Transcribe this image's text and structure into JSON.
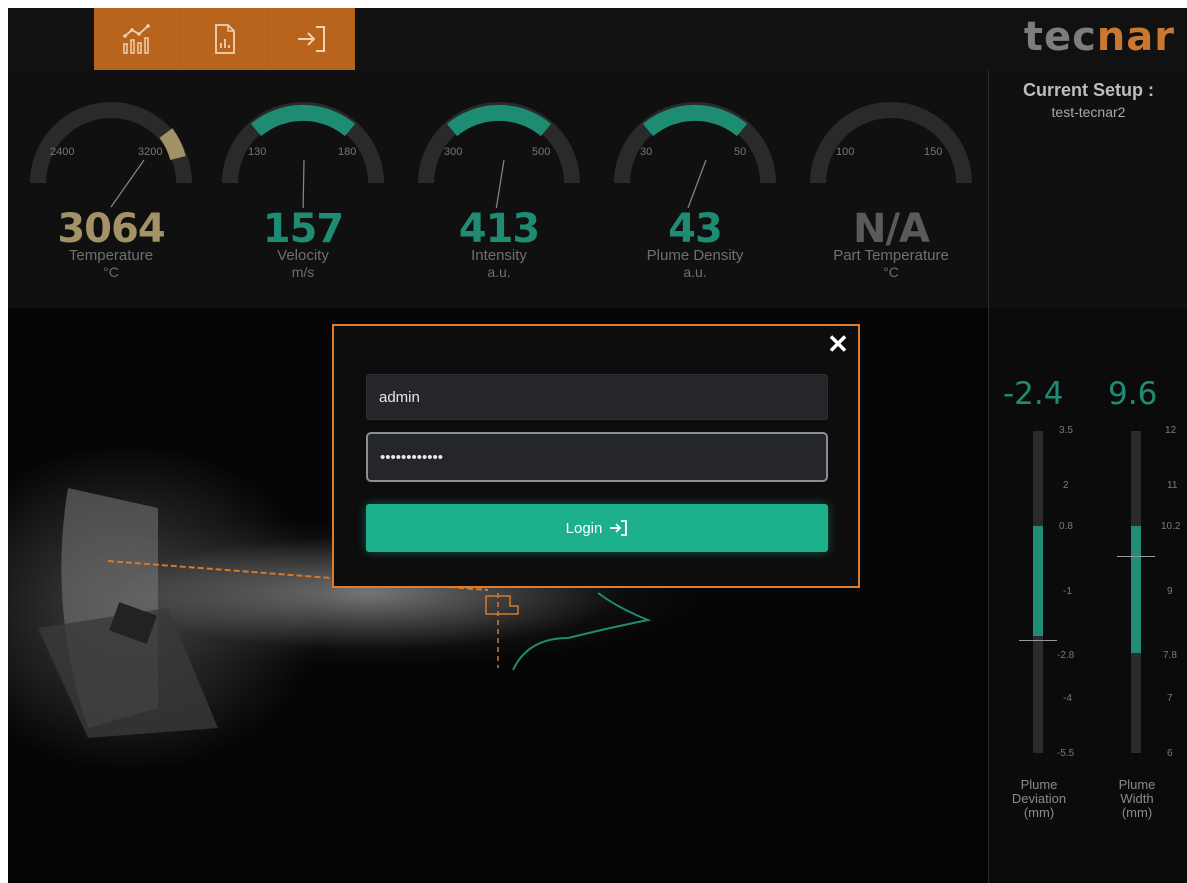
{
  "nav": {
    "tabs": [
      {
        "icon": "video-camera-icon"
      },
      {
        "icon": "chart-icon"
      },
      {
        "icon": "report-icon"
      },
      {
        "icon": "login-icon"
      }
    ]
  },
  "brand": {
    "logo_part1": "tec",
    "logo_part2": "nar",
    "accent": "#c87830"
  },
  "metrics": [
    {
      "value": "3064",
      "name": "Temperature",
      "unit": "°C",
      "tick_min": "2400",
      "tick_max": "3200",
      "color": "#a39266"
    },
    {
      "value": "157",
      "name": "Velocity",
      "unit": "m/s",
      "tick_min": "130",
      "tick_max": "180",
      "color": "#1e8c73"
    },
    {
      "value": "413",
      "name": "Intensity",
      "unit": "a.u.",
      "tick_min": "300",
      "tick_max": "500",
      "color": "#1e8c73"
    },
    {
      "value": "43",
      "name": "Plume Density",
      "unit": "a.u.",
      "tick_min": "30",
      "tick_max": "50",
      "color": "#1e8c73"
    },
    {
      "value": "N/A",
      "name": "Part Temperature",
      "unit": "°C",
      "tick_min": "100",
      "tick_max": "150",
      "color": "#5a5a5a"
    }
  ],
  "setup": {
    "title": "Current Setup :",
    "name": "test-tecnar2"
  },
  "side": {
    "deviation": {
      "value": "-2.4",
      "label_line1": "Plume",
      "label_line2": "Deviation",
      "label_line3": "(mm)",
      "ticks": [
        "3.5",
        "2",
        "0.8",
        "-1",
        "-2.8",
        "-4",
        "-5.5"
      ]
    },
    "width": {
      "value": "9.6",
      "label_line1": "Plume",
      "label_line2": "Width",
      "label_line3": "(mm)",
      "ticks": [
        "12",
        "11",
        "10.2",
        "9",
        "7.8",
        "7",
        "6"
      ]
    }
  },
  "login": {
    "username": "admin",
    "password": "••••••••••••",
    "button_label": "Login"
  },
  "colors": {
    "green": "#1cb08c",
    "orange": "#b8641c",
    "modal_border": "#e07d2c"
  }
}
